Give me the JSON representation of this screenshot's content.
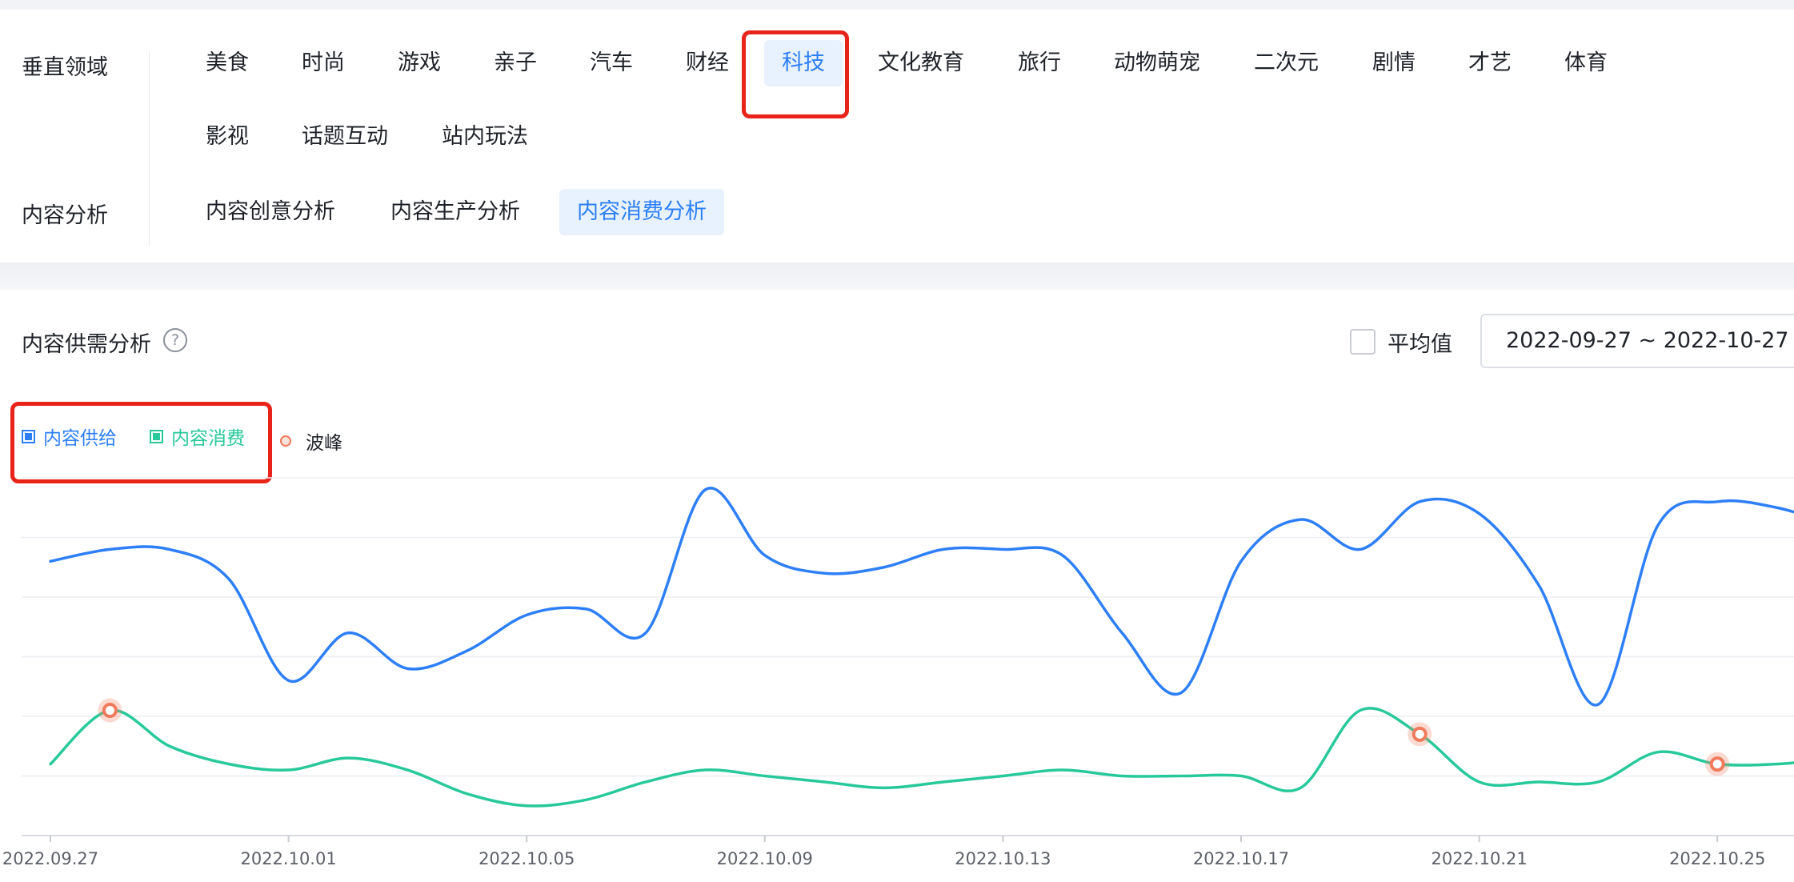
{
  "filters": {
    "vertical_label": "垂直领域",
    "vertical_tags": [
      "美食",
      "时尚",
      "游戏",
      "亲子",
      "汽车",
      "财经",
      "科技",
      "文化教育",
      "旅行",
      "动物萌宠",
      "二次元",
      "剧情",
      "才艺",
      "体育",
      "影视",
      "话题互动",
      "站内玩法"
    ],
    "vertical_selected": "科技",
    "content_label": "内容分析",
    "content_tags": [
      "内容创意分析",
      "内容生产分析",
      "内容消费分析"
    ],
    "content_selected": "内容消费分析"
  },
  "panel": {
    "title": "内容供需分析",
    "help_icon": "question-circle-icon",
    "average_label": "平均值",
    "average_checked": false,
    "date_range": "2022-09-27 ~ 2022-10-27"
  },
  "colors": {
    "supply": "#2d7ff9",
    "consume": "#27c99a",
    "peak": "#f07a5c",
    "active_bg": "#e8f1fe",
    "annotation_red": "#e8231a"
  },
  "chart_data": {
    "type": "line",
    "x": [
      "2022.09.27",
      "2022.09.28",
      "2022.09.29",
      "2022.09.30",
      "2022.10.01",
      "2022.10.02",
      "2022.10.03",
      "2022.10.04",
      "2022.10.05",
      "2022.10.06",
      "2022.10.07",
      "2022.10.08",
      "2022.10.09",
      "2022.10.10",
      "2022.10.11",
      "2022.10.12",
      "2022.10.13",
      "2022.10.14",
      "2022.10.15",
      "2022.10.16",
      "2022.10.17",
      "2022.10.18",
      "2022.10.19",
      "2022.10.20",
      "2022.10.21",
      "2022.10.22",
      "2022.10.23",
      "2022.10.24",
      "2022.10.25",
      "2022.10.26",
      "2022.10.27"
    ],
    "tick_labels": [
      "2022.09.27",
      "2022.10.01",
      "2022.10.05",
      "2022.10.09",
      "2022.10.13",
      "2022.10.17",
      "2022.10.21",
      "2022.10.25"
    ],
    "series": [
      {
        "name": "内容供给",
        "values": [
          4.6,
          4.8,
          4.8,
          4.3,
          2.6,
          3.4,
          2.8,
          3.1,
          3.7,
          3.8,
          3.4,
          5.8,
          4.7,
          4.4,
          4.5,
          4.8,
          4.8,
          4.7,
          3.4,
          2.4,
          4.6,
          5.3,
          4.8,
          5.6,
          5.4,
          4.2,
          2.2,
          5.2,
          5.6,
          5.5,
          5.2
        ]
      },
      {
        "name": "内容消费",
        "values": [
          1.2,
          2.1,
          1.5,
          1.2,
          1.1,
          1.3,
          1.1,
          0.7,
          0.5,
          0.6,
          0.9,
          1.1,
          1.0,
          0.9,
          0.8,
          0.9,
          1.0,
          1.1,
          1.0,
          1.0,
          1.0,
          0.8,
          2.1,
          1.7,
          0.9,
          0.9,
          0.9,
          1.4,
          1.2,
          1.2,
          1.3
        ]
      }
    ],
    "peaks": [
      {
        "series": "内容消费",
        "x": "2022.09.28"
      },
      {
        "series": "内容消费",
        "x": "2022.10.20"
      },
      {
        "series": "内容消费",
        "x": "2022.10.25"
      }
    ],
    "legend": [
      "内容供给",
      "内容消费",
      "波峰"
    ],
    "ylim": [
      0,
      6
    ],
    "grid": true,
    "legend_position": "top-left"
  }
}
